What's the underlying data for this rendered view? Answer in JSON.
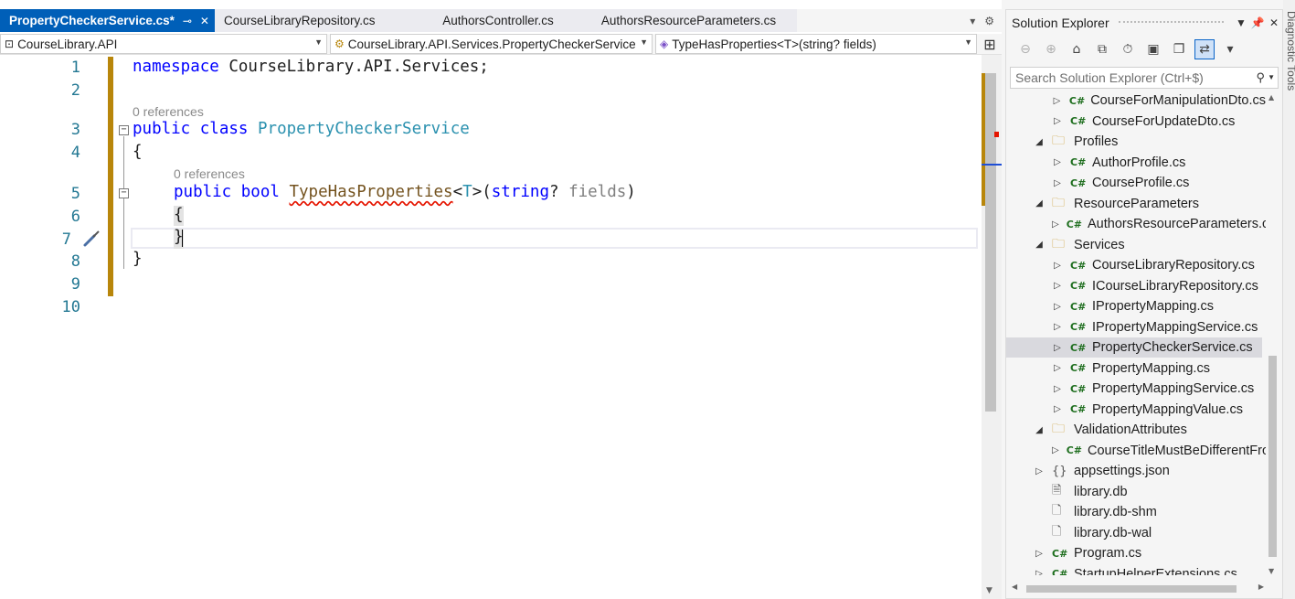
{
  "tabs": [
    {
      "label": "PropertyCheckerService.cs*",
      "active": true
    },
    {
      "label": "CourseLibraryRepository.cs",
      "active": false
    },
    {
      "label": "AuthorsController.cs",
      "active": false
    },
    {
      "label": "AuthorsResourceParameters.cs",
      "active": false
    }
  ],
  "navbar": {
    "project": "CourseLibrary.API",
    "type": "CourseLibrary.API.Services.PropertyCheckerService",
    "member": "TypeHasProperties<T>(string? fields)"
  },
  "editor": {
    "line_numbers": [
      "1",
      "2",
      "3",
      "4",
      "5",
      "6",
      "7",
      "8",
      "9",
      "10"
    ],
    "codelens_class": "0 references",
    "codelens_method": "0 references",
    "tokens": {
      "namespace_kw": "namespace",
      "namespace_name": " CourseLibrary.API.Services;",
      "public_kw": "public",
      "class_kw": "class",
      "class_name": "PropertyCheckerService",
      "open_brace": "{",
      "close_brace": "}",
      "bool_kw": "bool",
      "method_name": "TypeHasProperties",
      "generic_open": "<",
      "generic_t": "T",
      "generic_close": ">(",
      "string_kw": "string",
      "nullable": "?",
      "param_name": "fields",
      "close_paren": ")"
    }
  },
  "solution_explorer": {
    "title": "Solution Explorer",
    "search_placeholder": "Search Solution Explorer (Ctrl+$)",
    "items": [
      {
        "label": "CourseForManipulationDto.cs",
        "icon": "csharp-file-icon",
        "expander": "collapsed"
      },
      {
        "label": "CourseForUpdateDto.cs",
        "icon": "csharp-file-icon",
        "expander": "collapsed"
      },
      {
        "label": "Profiles",
        "icon": "folder-icon",
        "expander": "expanded"
      },
      {
        "label": "AuthorProfile.cs",
        "icon": "csharp-file-icon",
        "expander": "collapsed"
      },
      {
        "label": "CourseProfile.cs",
        "icon": "csharp-file-icon",
        "expander": "collapsed"
      },
      {
        "label": "ResourceParameters",
        "icon": "folder-icon",
        "expander": "expanded"
      },
      {
        "label": "AuthorsResourceParameters.cs",
        "icon": "csharp-file-icon",
        "expander": "collapsed"
      },
      {
        "label": "Services",
        "icon": "folder-icon",
        "expander": "expanded"
      },
      {
        "label": "CourseLibraryRepository.cs",
        "icon": "csharp-file-icon",
        "expander": "collapsed"
      },
      {
        "label": "ICourseLibraryRepository.cs",
        "icon": "csharp-file-icon",
        "expander": "collapsed"
      },
      {
        "label": "IPropertyMapping.cs",
        "icon": "csharp-file-icon",
        "expander": "collapsed"
      },
      {
        "label": "IPropertyMappingService.cs",
        "icon": "csharp-file-icon",
        "expander": "collapsed"
      },
      {
        "label": "PropertyCheckerService.cs",
        "icon": "csharp-file-icon",
        "expander": "collapsed",
        "selected": true
      },
      {
        "label": "PropertyMapping.cs",
        "icon": "csharp-file-icon",
        "expander": "collapsed"
      },
      {
        "label": "PropertyMappingService.cs",
        "icon": "csharp-file-icon",
        "expander": "collapsed"
      },
      {
        "label": "PropertyMappingValue.cs",
        "icon": "csharp-file-icon",
        "expander": "collapsed"
      },
      {
        "label": "ValidationAttributes",
        "icon": "folder-icon",
        "expander": "expanded"
      },
      {
        "label": "CourseTitleMustBeDifferentFrom",
        "icon": "csharp-file-icon",
        "expander": "collapsed"
      },
      {
        "label": "appsettings.json",
        "icon": "json-file-icon",
        "expander": "collapsed"
      },
      {
        "label": "library.db",
        "icon": "db-file-icon",
        "expander": "none"
      },
      {
        "label": "library.db-shm",
        "icon": "file-icon",
        "expander": "none"
      },
      {
        "label": "library.db-wal",
        "icon": "file-icon",
        "expander": "none"
      },
      {
        "label": "Program.cs",
        "icon": "csharp-file-icon",
        "expander": "collapsed"
      },
      {
        "label": "StartupHelperExtensions.cs",
        "icon": "csharp-file-icon",
        "expander": "collapsed"
      }
    ]
  },
  "side_strip_label": "Diagnostic Tools",
  "colors": {
    "active_tab": "#005fb8",
    "keyword": "#0000ff",
    "type_name": "#2b91af",
    "method_name": "#74531f",
    "change_bar": "#b8860b",
    "selection": "#d9d9de"
  }
}
